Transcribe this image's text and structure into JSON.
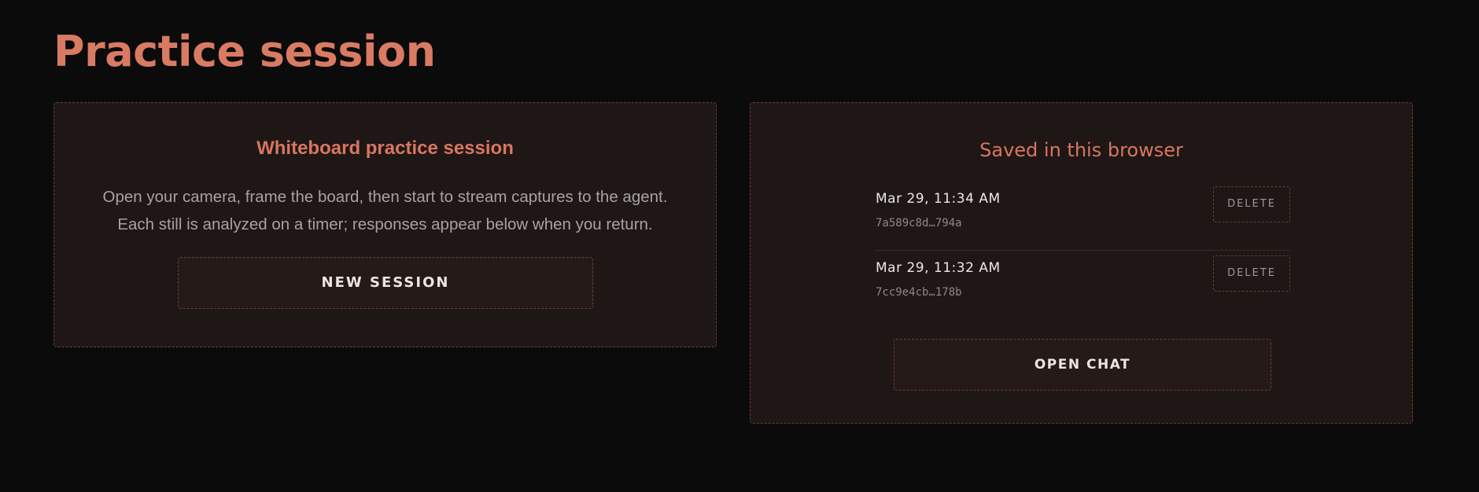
{
  "page": {
    "title": "Practice session"
  },
  "whiteboard": {
    "heading": "Whiteboard practice session",
    "description_line1": "Open your camera, frame the board, then start to stream captures to the agent.",
    "description_line2": "Each still is analyzed on a timer; responses appear below when you return.",
    "new_session_label": "NEW SESSION"
  },
  "saved": {
    "heading": "Saved in this browser",
    "sessions": [
      {
        "date": "Mar 29, 11:34 AM",
        "id": "7a589c8d…794a",
        "delete_label": "DELETE"
      },
      {
        "date": "Mar 29, 11:32 AM",
        "id": "7cc9e4cb…178b",
        "delete_label": "DELETE"
      }
    ],
    "open_chat_label": "OPEN CHAT"
  },
  "colors": {
    "background": "#0b0b0b",
    "card": "#1e1716",
    "accent": "#d97a63",
    "border": "#6b3d33"
  }
}
